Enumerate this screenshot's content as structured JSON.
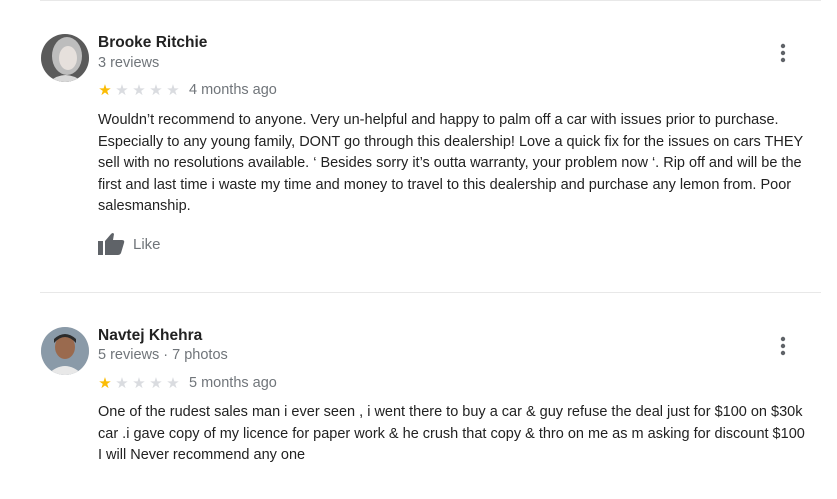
{
  "reviews": [
    {
      "name": "Brooke Ritchie",
      "meta": "3 reviews",
      "rating": 1,
      "max_rating": 5,
      "date": "4 months ago",
      "text": [
        "Wouldn’t recommend to anyone. Very un-helpful and happy to palm off a car with issues prior to purchase. Especially to any young family, DONT go through this dealership! Love a quick fix for the issues on cars THEY sell with no resolutions available. ‘ Besides sorry it’s outta warranty, your problem now ‘. Rip off and will be the first and last time i waste my time and money to travel to this dealership and purchase any lemon from. Poor salesmanship."
      ],
      "like_label": "Like"
    },
    {
      "name": "Navtej Khehra",
      "meta": "5 reviews · 7 photos",
      "rating": 1,
      "max_rating": 5,
      "date": "5 months ago",
      "text": [
        "One of the rudest sales man i ever seen , i went there to buy a car & guy refuse the deal just for $100 on $30k car .i gave copy of my licence for paper work & he crush that copy & thro on me as m asking for discount $100",
        "I will Never recommend any one"
      ]
    }
  ],
  "icons": {
    "more": "more-vert-icon",
    "like": "thumbs-up-icon",
    "star": "star-icon"
  },
  "colors": {
    "star_filled": "#fbbc04",
    "star_empty": "#dadce0",
    "secondary_text": "#70757a"
  }
}
